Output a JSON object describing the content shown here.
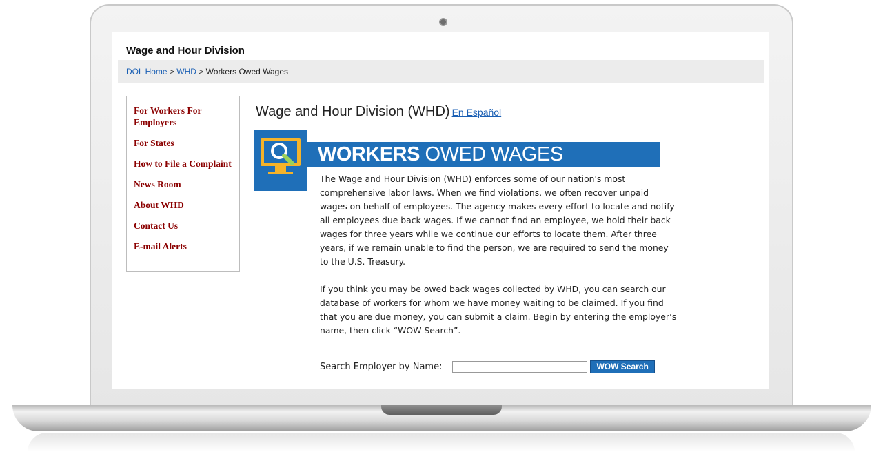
{
  "site": {
    "title": "Wage and Hour Division"
  },
  "breadcrumb": {
    "home": "DOL Home",
    "sep1": ">",
    "whd": "WHD",
    "sep2": ">",
    "current": "Workers Owed Wages"
  },
  "sidebar": {
    "items": [
      {
        "label": "For Workers For Employers"
      },
      {
        "label": "For States"
      },
      {
        "label": "How to File a Complaint"
      },
      {
        "label": "News Room"
      },
      {
        "label": "About WHD"
      },
      {
        "label": "Contact Us"
      },
      {
        "label": "E-mail Alerts"
      }
    ]
  },
  "main": {
    "heading": "Wage and Hour Division (WHD)",
    "spanish_link": "En Español",
    "banner": {
      "bold": "WORKERS",
      "light": "OWED WAGES"
    },
    "paragraph1": "The Wage and Hour Division (WHD) enforces some of our nation's most comprehensive labor laws. When we find violations, we often recover unpaid wages on behalf of employees. The agency makes every effort to locate and notify all employees due back wages. If we cannot find an employee, we hold their back wages for three years while we continue our efforts to locate them. After three years, if we remain unable to find the person, we are required to send the money to the U.S. Treasury.",
    "paragraph2": "If you think you may be owed back wages collected by WHD, you can search our database of workers for whom we have money waiting to be claimed. If you find that you are due money, you can submit a claim. Begin by entering the employer’s name, then click “WOW Search”.",
    "search": {
      "label": "Search Employer by Name:",
      "value": "",
      "button": "WOW Search"
    }
  },
  "colors": {
    "brand_blue": "#1f6fb8",
    "sidebar_link": "#8b0000",
    "link": "#1a5fb4"
  }
}
